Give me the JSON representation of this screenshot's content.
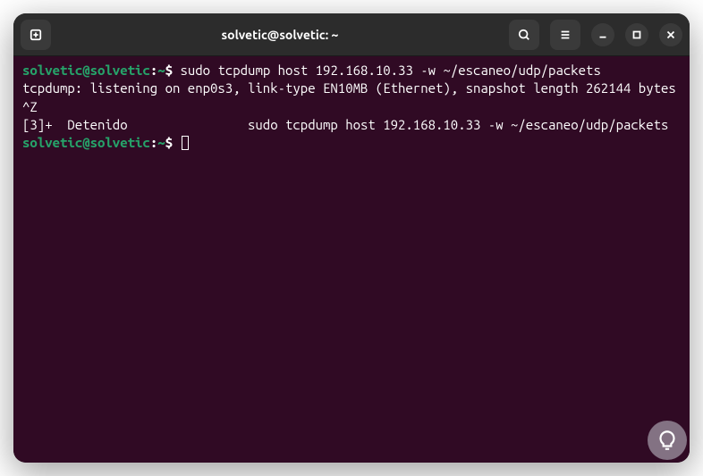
{
  "titlebar": {
    "title": "solvetic@solvetic: ~",
    "icons": {
      "new_tab": "new-tab-icon",
      "search": "search-icon",
      "menu": "hamburger-icon",
      "minimize": "minimize-icon",
      "maximize": "maximize-icon",
      "close": "close-icon"
    }
  },
  "terminal": {
    "lines": [
      {
        "prompt_user": "solvetic@solvetic",
        "prompt_sep": ":",
        "prompt_path": "~",
        "prompt_end": "$ ",
        "command": "sudo tcpdump host 192.168.10.33 -w ~/escaneo/udp/packets"
      },
      {
        "output": "tcpdump: listening on enp0s3, link-type EN10MB (Ethernet), snapshot length 262144 bytes"
      },
      {
        "output": "^Z"
      },
      {
        "output": "[3]+  Detenido                sudo tcpdump host 192.168.10.33 -w ~/escaneo/udp/packets"
      },
      {
        "prompt_user": "solvetic@solvetic",
        "prompt_sep": ":",
        "prompt_path": "~",
        "prompt_end": "$ ",
        "cursor": true
      }
    ]
  },
  "watermark": {
    "icon": "bulb-icon"
  }
}
